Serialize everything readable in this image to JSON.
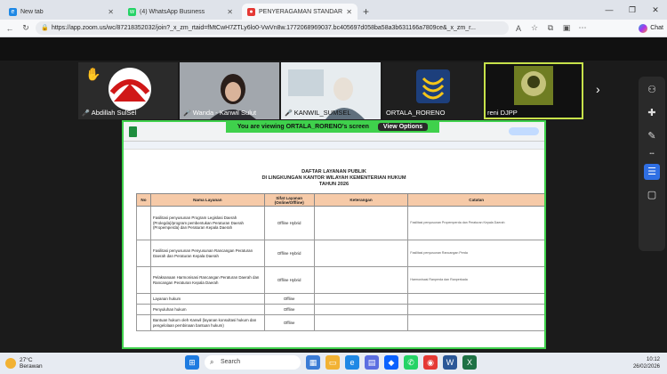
{
  "browser": {
    "tabs": [
      {
        "label": "New tab",
        "icon": "edge-icon",
        "color": "#1e88e5",
        "active": false
      },
      {
        "label": "(4) WhatsApp Business",
        "icon": "whatsapp-icon",
        "color": "#25d366",
        "active": false
      },
      {
        "label": "PENYERAGAMAN STANDAR P",
        "icon": "zoom-icon",
        "color": "#e53935",
        "active": true
      }
    ],
    "new_tab_glyph": "+",
    "url": "https://app.zoom.us/wc/87218352032/join?_x_zm_rtaid=fMtCwH7ZTLy6lo0-VwVn8w.1772068969037.bc405697d058ba58a3b631166a7809ce&_x_zm_r...",
    "copilot_label": "Chat"
  },
  "zoom": {
    "participants": [
      {
        "name": "Abdillah SulSel",
        "muted": true,
        "highlight": false
      },
      {
        "name": "Wanda - Kanwil Sulut",
        "muted": true,
        "highlight": false
      },
      {
        "name": "KANWIL_SUMSEL",
        "muted": true,
        "highlight": false
      },
      {
        "name": "ORTALA_RORENO",
        "muted": false,
        "highlight": false
      },
      {
        "name": "reni DJPP",
        "muted": false,
        "highlight": true
      }
    ],
    "viewing_banner": "You are viewing ORTALA_RORENO's screen",
    "view_options": "View Options"
  },
  "document": {
    "title_lines": [
      "DAFTAR LAYANAN PUBLIK",
      "DI LINGKUNGAN KANTOR WILAYAH KEMENTERIAN HUKUM",
      "TAHUN 2026"
    ],
    "columns": [
      "No",
      "Nama Layanan",
      "Sifat Layanan (Online/Offline)",
      "Keterangan",
      "Catatan"
    ],
    "rows": [
      {
        "no": "",
        "nama": "Fasilitasi penyusunan Program Legislasi Daerah (Prolegda)/program pembentukan Peraturan Daerah (Propemperda) dan Peraturan Kepala Daerah",
        "sifat": "Offline Hybrid",
        "ket": "",
        "cat": "Fasilitasi penyusunan Propemperda dan Peraturan Kepala Daerah"
      },
      {
        "no": "",
        "nama": "Fasilitasi penyusunan Penyusunan Rancangan Peraturan Daerah dan Peraturan Kepala Daerah",
        "sifat": "Offline Hybrid",
        "ket": "",
        "cat": "Fasilitasi penyusunan Rancangan Perda"
      },
      {
        "no": "",
        "nama": "Pelaksanaan Harmonisasi Rancangan Peraturan Daerah dan Rancangan Peraturan Kepala Daerah",
        "sifat": "Offline Hybrid",
        "ket": "",
        "cat": "Harmonisasi Ranperda dan Ranperkada"
      },
      {
        "no": "",
        "nama": "Layanan hukum",
        "sifat": "Offline",
        "ket": "",
        "cat": ""
      },
      {
        "no": "",
        "nama": "Penyuluhan hukum",
        "sifat": "Offline",
        "ket": "",
        "cat": ""
      },
      {
        "no": "",
        "nama": "Bantuan hukum oleh Kanwil (layanan konsultasi hukum dan pengelolaan pembinaan bantuan hukum)",
        "sifat": "Offline",
        "ket": "",
        "cat": ""
      }
    ]
  },
  "taskbar": {
    "weather_temp": "27°C",
    "weather_desc": "Berawan",
    "search_label": "Search",
    "time": "10:12",
    "date": "26/02/2026"
  }
}
